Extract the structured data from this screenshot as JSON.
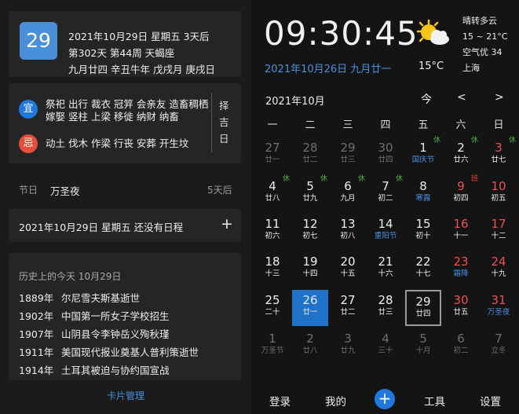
{
  "today_card": {
    "day": "29",
    "line1": "2021年10月29日 星期五 3天后",
    "line2": "第302天 第44周 天蝎座",
    "line3": "九月廿四 辛丑牛年 戊戌月 庚戌日"
  },
  "almanac": {
    "yi_label": "宜",
    "yi_text": "祭祀 出行 裁衣 冠笄 会亲友 造畜稠栖 嫁娶 竖柱 上梁 移徙 纳财 纳畜",
    "ji_label": "忌",
    "ji_text": "动土 伐木 作梁 行丧 安葬 开生坟",
    "zeji": "择吉日"
  },
  "festival": {
    "label": "节日",
    "name": "万圣夜",
    "days": "5天后"
  },
  "schedule": {
    "text": "2021年10月29日 星期五 还没有日程",
    "add": "+"
  },
  "history": {
    "title": "历史上的今天 10月29日",
    "items": [
      {
        "year": "1889年",
        "event": "尔尼雪夫斯基逝世"
      },
      {
        "year": "1902年",
        "event": "中国第一所女子学校招生"
      },
      {
        "year": "1907年",
        "event": "山阴县令李钟岳义殉秋瑾"
      },
      {
        "year": "1911年",
        "event": "美国现代报业奠基人普利策逝世"
      },
      {
        "year": "1914年",
        "event": "土耳其被迫与协约国宣战"
      }
    ]
  },
  "card_manage": "卡片管理",
  "clock": {
    "time": "09:30:45",
    "date": "2021年10月26日 九月廿一"
  },
  "weather": {
    "desc": "晴转多云",
    "range": "15 ~ 21°C",
    "air": "空气优 34",
    "city": "上海",
    "temp": "15°C",
    "icon": "sun-cloud-icon"
  },
  "calendar": {
    "month": "2021年10月",
    "today_btn": "今",
    "prev": "<",
    "next": ">",
    "weekdays": [
      "一",
      "二",
      "三",
      "四",
      "五",
      "六",
      "日"
    ],
    "weeks": [
      [
        {
          "n": "27",
          "l": "廿一",
          "type": "dim"
        },
        {
          "n": "28",
          "l": "廿二",
          "type": "dim"
        },
        {
          "n": "29",
          "l": "廿三",
          "type": "dim"
        },
        {
          "n": "30",
          "l": "廿四",
          "type": "dim"
        },
        {
          "n": "1",
          "l": "国庆节",
          "type": "fest",
          "tag": "休"
        },
        {
          "n": "2",
          "l": "廿六",
          "type": "normal",
          "tag": "休"
        },
        {
          "n": "3",
          "l": "廿七",
          "type": "wkend",
          "tag": "休"
        }
      ],
      [
        {
          "n": "4",
          "l": "廿八",
          "type": "normal",
          "tag": "休"
        },
        {
          "n": "5",
          "l": "廿九",
          "type": "normal",
          "tag": "休"
        },
        {
          "n": "6",
          "l": "九月",
          "type": "normal",
          "tag": "休"
        },
        {
          "n": "7",
          "l": "初二",
          "type": "normal",
          "tag": "休"
        },
        {
          "n": "8",
          "l": "寒露",
          "type": "fest"
        },
        {
          "n": "9",
          "l": "初四",
          "type": "wkend",
          "tag": "班"
        },
        {
          "n": "10",
          "l": "初五",
          "type": "wkend"
        }
      ],
      [
        {
          "n": "11",
          "l": "初六",
          "type": "normal"
        },
        {
          "n": "12",
          "l": "初七",
          "type": "normal"
        },
        {
          "n": "13",
          "l": "初八",
          "type": "normal"
        },
        {
          "n": "14",
          "l": "重阳节",
          "type": "fest"
        },
        {
          "n": "15",
          "l": "初十",
          "type": "normal"
        },
        {
          "n": "16",
          "l": "十一",
          "type": "wkend"
        },
        {
          "n": "17",
          "l": "十二",
          "type": "wkend"
        }
      ],
      [
        {
          "n": "18",
          "l": "十三",
          "type": "normal"
        },
        {
          "n": "19",
          "l": "十四",
          "type": "normal"
        },
        {
          "n": "20",
          "l": "十五",
          "type": "normal"
        },
        {
          "n": "21",
          "l": "十六",
          "type": "normal"
        },
        {
          "n": "22",
          "l": "十七",
          "type": "normal"
        },
        {
          "n": "23",
          "l": "霜降",
          "type": "wkend fest"
        },
        {
          "n": "24",
          "l": "十九",
          "type": "wkend"
        }
      ],
      [
        {
          "n": "25",
          "l": "二十",
          "type": "normal"
        },
        {
          "n": "26",
          "l": "廿一",
          "type": "today"
        },
        {
          "n": "27",
          "l": "廿二",
          "type": "normal"
        },
        {
          "n": "28",
          "l": "廿三",
          "type": "normal"
        },
        {
          "n": "29",
          "l": "廿四",
          "type": "sel"
        },
        {
          "n": "30",
          "l": "廿五",
          "type": "wkend"
        },
        {
          "n": "31",
          "l": "万圣夜",
          "type": "wkend fest"
        }
      ],
      [
        {
          "n": "1",
          "l": "万圣节",
          "type": "dim"
        },
        {
          "n": "2",
          "l": "廿八",
          "type": "dim"
        },
        {
          "n": "3",
          "l": "廿九",
          "type": "dim"
        },
        {
          "n": "4",
          "l": "三十",
          "type": "dim"
        },
        {
          "n": "5",
          "l": "十月",
          "type": "dim"
        },
        {
          "n": "6",
          "l": "初二",
          "type": "dim"
        },
        {
          "n": "7",
          "l": "立冬",
          "type": "dim"
        }
      ]
    ]
  },
  "bottom": {
    "login": "登录",
    "mine": "我的",
    "add": "+",
    "tools": "工具",
    "settings": "设置"
  },
  "colors": {
    "accent": "#1e78e0",
    "link": "#4a90e2",
    "weekend": "#f05050",
    "holiday": "#4caf50"
  }
}
